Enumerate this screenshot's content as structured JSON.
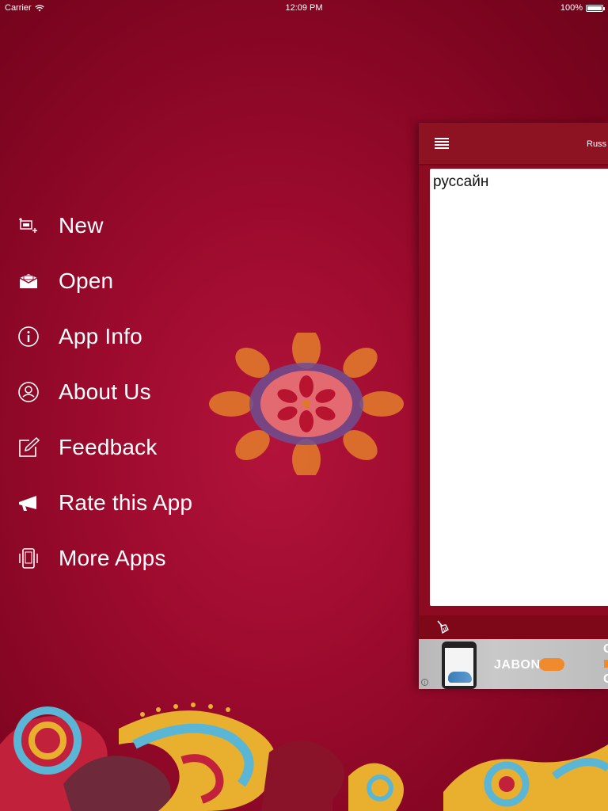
{
  "status_bar": {
    "carrier": "Carrier",
    "time": "12:09 PM",
    "battery": "100%"
  },
  "menu": {
    "items": [
      {
        "label": "New",
        "icon": "new-document-icon"
      },
      {
        "label": "Open",
        "icon": "open-folder-icon"
      },
      {
        "label": "App Info",
        "icon": "info-icon"
      },
      {
        "label": "About Us",
        "icon": "user-circle-icon"
      },
      {
        "label": "Feedback",
        "icon": "edit-icon"
      },
      {
        "label": "Rate this App",
        "icon": "megaphone-icon"
      },
      {
        "label": "More Apps",
        "icon": "phone-apps-icon"
      }
    ]
  },
  "panel": {
    "title": "Russ",
    "text_content": "руссайн",
    "menu_icon": "hamburger-icon",
    "clear_icon": "broom-icon"
  },
  "ad": {
    "brand": "JABONG",
    "text_top": "O",
    "text_bottom": "O"
  },
  "colors": {
    "background": "#9a0a2c",
    "panel_header": "#8d1323",
    "ad_accent": "#f08a2c"
  }
}
